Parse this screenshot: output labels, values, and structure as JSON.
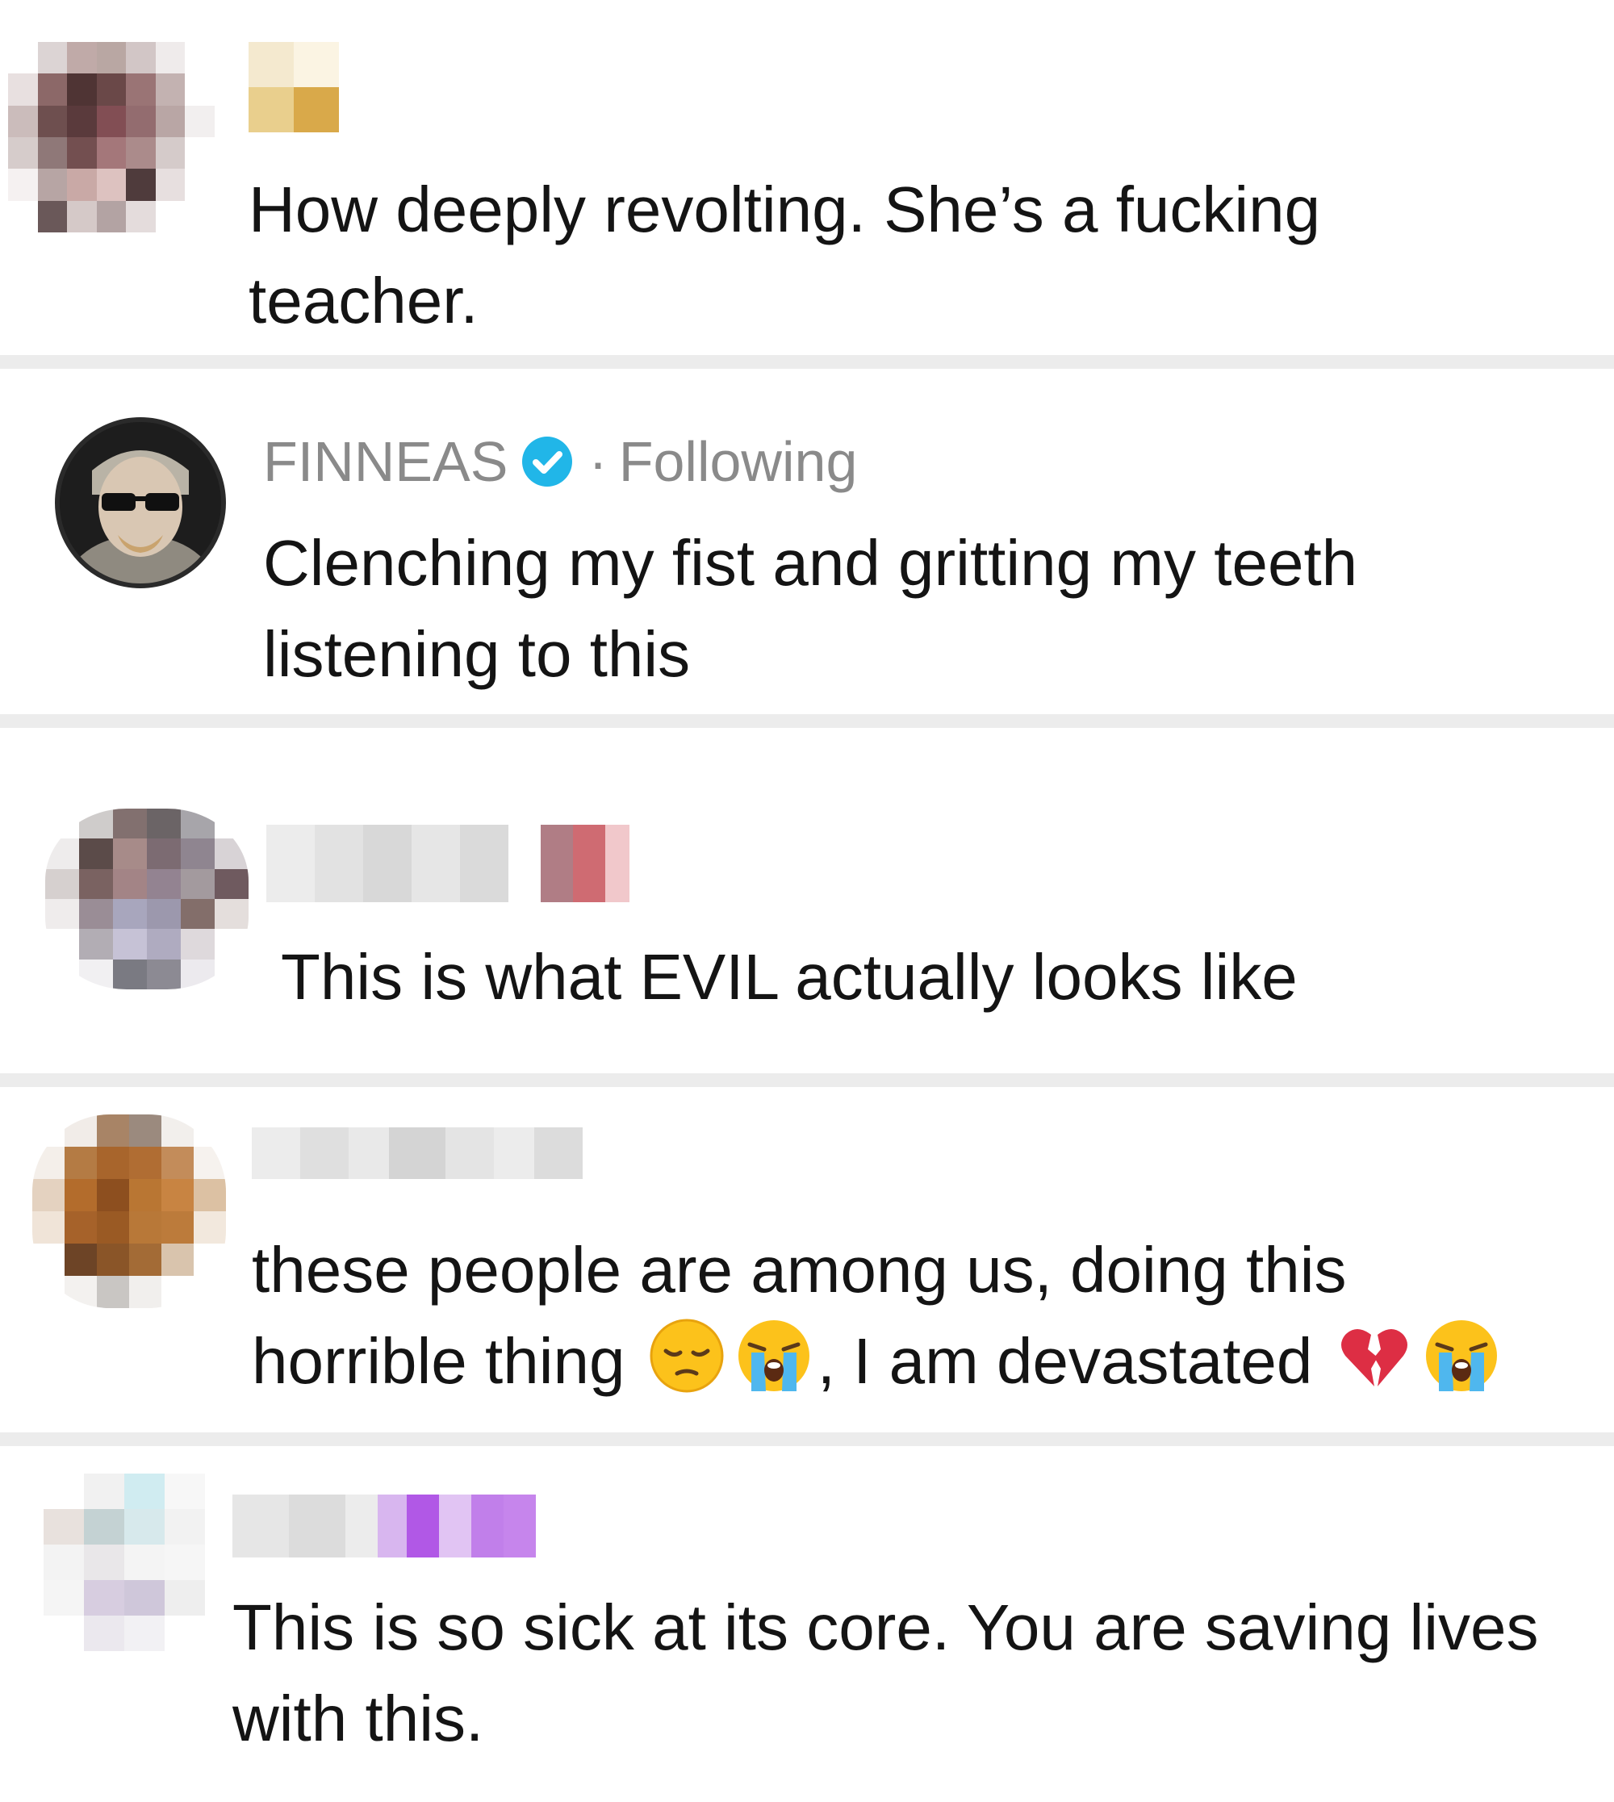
{
  "comments": [
    {
      "username": "",
      "text_lines": [
        "How deeply revolting. She’s a fucking",
        "teacher."
      ]
    },
    {
      "username": "FINNEAS",
      "verified": true,
      "separator": "·",
      "relation": "Following",
      "text_lines": [
        "Clenching my fist and gritting my teeth",
        "listening to this"
      ]
    },
    {
      "username": "",
      "text_lines": [
        "This is what EVIL actually looks like"
      ]
    },
    {
      "username": "",
      "text_lines": [
        "these people are among us, doing this",
        "horrible thing",
        ", I am devastated"
      ],
      "emojis": [
        "pensive-face-emoji",
        "loudly-crying-face-emoji",
        "broken-heart-emoji",
        "loudly-crying-face-emoji"
      ]
    },
    {
      "username": "",
      "text_lines": [
        "This is so sick at its core. You are saving lives",
        "with this."
      ]
    }
  ],
  "colors": {
    "divider": "#ececec",
    "verified_badge": "#21b6e8",
    "meta_text": "#8a8a8a",
    "comment_text": "#141414"
  }
}
